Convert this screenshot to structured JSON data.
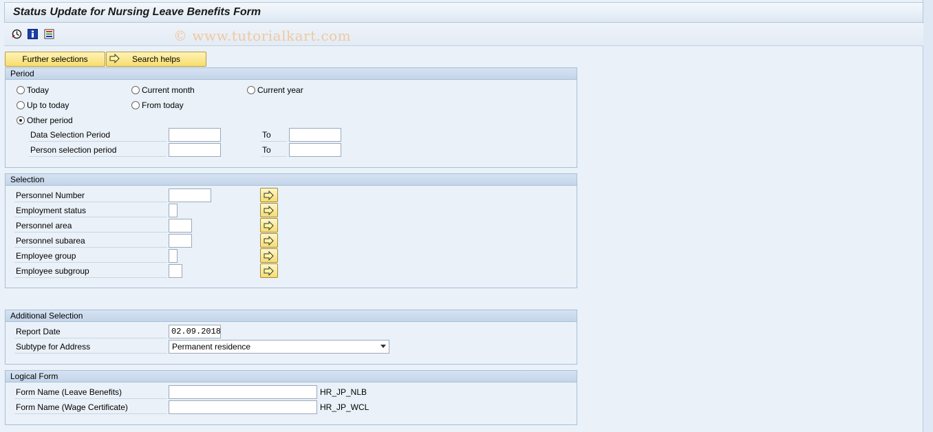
{
  "window": {
    "title": "Status Update for Nursing Leave Benefits Form",
    "watermark": "© www.tutorialkart.com"
  },
  "toolbar": {
    "icons": [
      "execute-icon",
      "info-icon",
      "variant-icon"
    ]
  },
  "buttons": {
    "further_selections": "Further selections",
    "search_helps": "Search helps"
  },
  "period": {
    "header": "Period",
    "radios": {
      "today": "Today",
      "current_month": "Current month",
      "current_year": "Current year",
      "up_to_today": "Up to today",
      "from_today": "From today",
      "other_period": "Other period"
    },
    "selected": "other_period",
    "data_selection_label": "Data Selection Period",
    "person_selection_label": "Person selection period",
    "to_label": "To",
    "data_from": "",
    "data_to": "",
    "person_from": "",
    "person_to": ""
  },
  "selection": {
    "header": "Selection",
    "fields": [
      {
        "label": "Personnel Number",
        "value": ""
      },
      {
        "label": "Employment status",
        "value": ""
      },
      {
        "label": "Personnel area",
        "value": ""
      },
      {
        "label": "Personnel subarea",
        "value": ""
      },
      {
        "label": "Employee group",
        "value": ""
      },
      {
        "label": "Employee subgroup",
        "value": ""
      }
    ]
  },
  "additional": {
    "header": "Additional Selection",
    "report_date_label": "Report Date",
    "report_date_value": "02.09.2018",
    "subtype_label": "Subtype for Address",
    "subtype_value": "Permanent residence"
  },
  "logical_form": {
    "header": "Logical Form",
    "leave_label": "Form Name (Leave Benefits)",
    "leave_value": "",
    "leave_default": "HR_JP_NLB",
    "wage_label": "Form Name (Wage Certificate)",
    "wage_value": "",
    "wage_default": "HR_JP_WCL"
  }
}
